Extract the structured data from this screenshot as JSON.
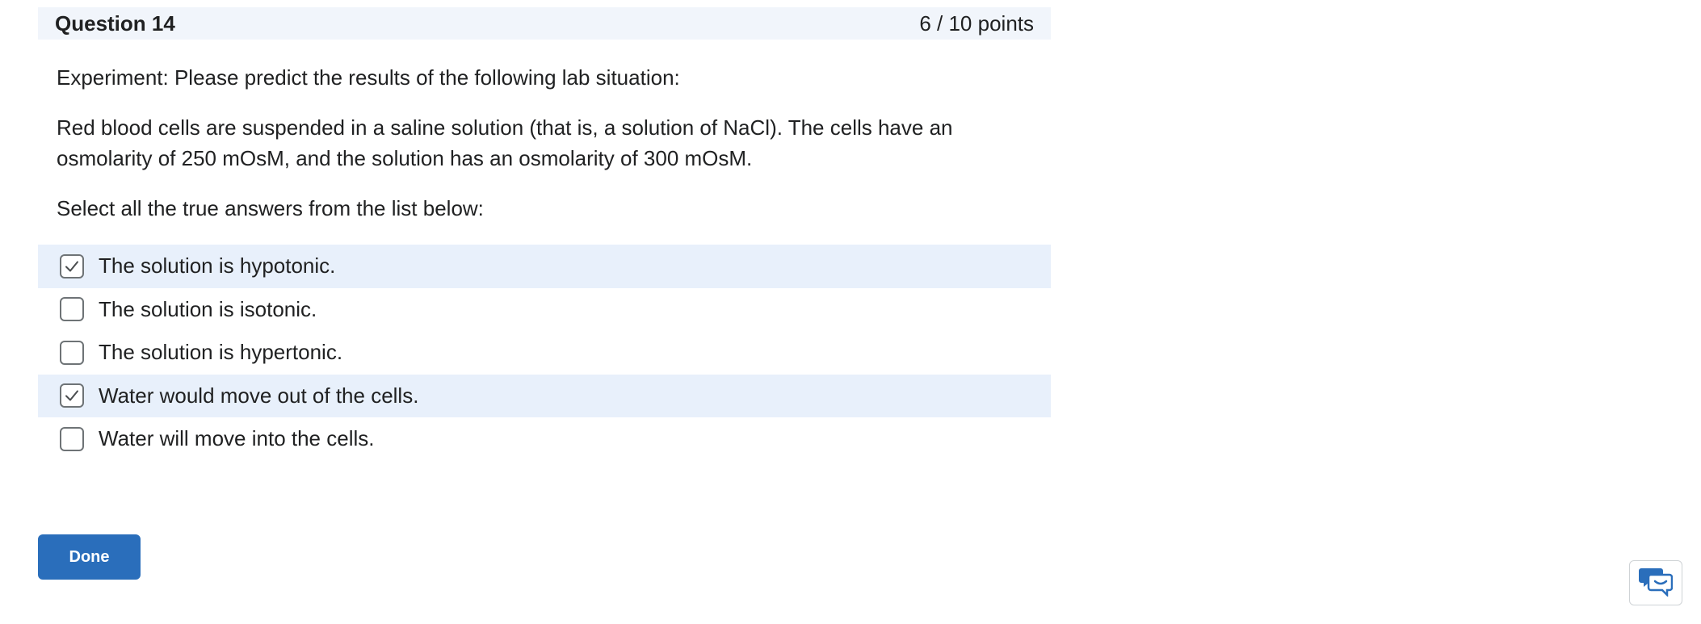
{
  "question": {
    "title": "Question 14",
    "points": "6 / 10 points",
    "paragraphs": [
      "Experiment: Please predict the results of the following lab situation:",
      "Red blood cells are suspended in a saline solution (that is, a solution of NaCl). The cells have an osmolarity of 250 mOsM, and the solution has an osmolarity of 300 mOsM.",
      "Select all the true answers from the list below:"
    ],
    "options": [
      {
        "label": "The solution is hypotonic.",
        "checked": true
      },
      {
        "label": "The solution is isotonic.",
        "checked": false
      },
      {
        "label": "The solution is hypertonic.",
        "checked": false
      },
      {
        "label": "Water would move out of the cells.",
        "checked": true
      },
      {
        "label": "Water will move into the cells.",
        "checked": false
      }
    ]
  },
  "actions": {
    "done_label": "Done"
  },
  "icons": {
    "checkmark": "checkmark-icon",
    "feedback": "chat-bubbles-icon"
  },
  "colors": {
    "header_bg": "#f1f5fb",
    "selected_bg": "#e8f0fb",
    "primary_button": "#2a6ebb"
  }
}
